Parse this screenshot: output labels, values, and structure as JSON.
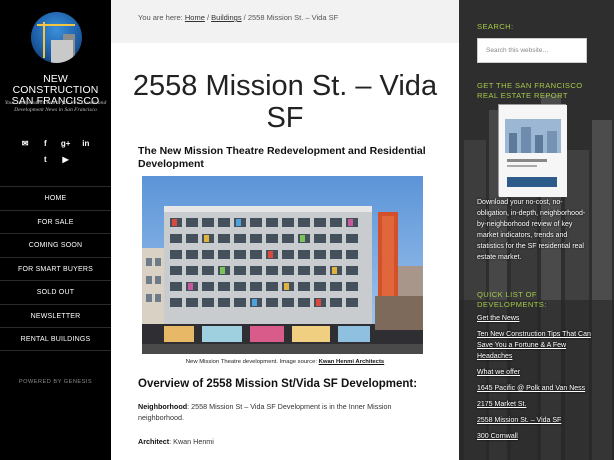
{
  "site": {
    "title_line1": "NEW CONSTRUCTION",
    "title_line2": "SAN FRANCISCO",
    "description": "Your Independent Source for New Condo and Development News in San Francisco"
  },
  "social": {
    "row1": [
      "✉",
      "f",
      "g+",
      "in"
    ],
    "row2": [
      "t",
      "▶"
    ]
  },
  "nav": [
    {
      "label": "HOME"
    },
    {
      "label": "FOR SALE"
    },
    {
      "label": "COMING SOON"
    },
    {
      "label": "FOR SMART BUYERS"
    },
    {
      "label": "SOLD OUT"
    },
    {
      "label": "NEWSLETTER"
    },
    {
      "label": "RENTAL BUILDINGS"
    }
  ],
  "powered_by": "POWERED BY GENESIS",
  "breadcrumb": {
    "prefix": "You are here:",
    "home": "Home",
    "sep1": " / ",
    "buildings": "Buildings",
    "sep2": " / ",
    "current": "2558 Mission St. – Vida SF"
  },
  "post": {
    "title": "2558 Mission St. – Vida SF",
    "subhead": "The New Mission Theatre Redevelopment and Residential Development",
    "caption_text": "New Mission Theatre development. Image source:",
    "caption_link": "Kwan Henmi Architects",
    "overview_heading": "Overview of 2558 Mission St/Vida SF Development:",
    "neighborhood_label": "Neighborhood",
    "neighborhood_text": ": 2558 Mission St – Vida SF Development is in the Inner Mission neighborhood.",
    "architect_label": "Architect",
    "architect_text": ": Kwan Henmi"
  },
  "sidebar": {
    "search_heading": "SEARCH:",
    "search_placeholder": "Search this website…",
    "report_heading": "GET THE SAN FRANCISCO REAL ESTATE REPORT",
    "report_text": "Download your no-cost, no-obligation, in-depth, neighborhood-by-neighborhood review of key market indicators, trends and statistics for the SF residential real estate market.",
    "devs_heading": "QUICK LIST OF DEVELOPMENTS:",
    "dev_links": [
      "Get the News",
      "Ten New Construction Tips That Can Save You a Fortune & A Few Headaches",
      "What we offer",
      "1645 Pacific @ Polk and Van Ness",
      "2175 Market St.",
      "2558 Mission St. – Vida SF",
      "300 Cornwall"
    ]
  },
  "colors": {
    "accent_green": "#a4c84a",
    "sidebar_bg": "#000000",
    "tower_orange": "#d4502a"
  }
}
